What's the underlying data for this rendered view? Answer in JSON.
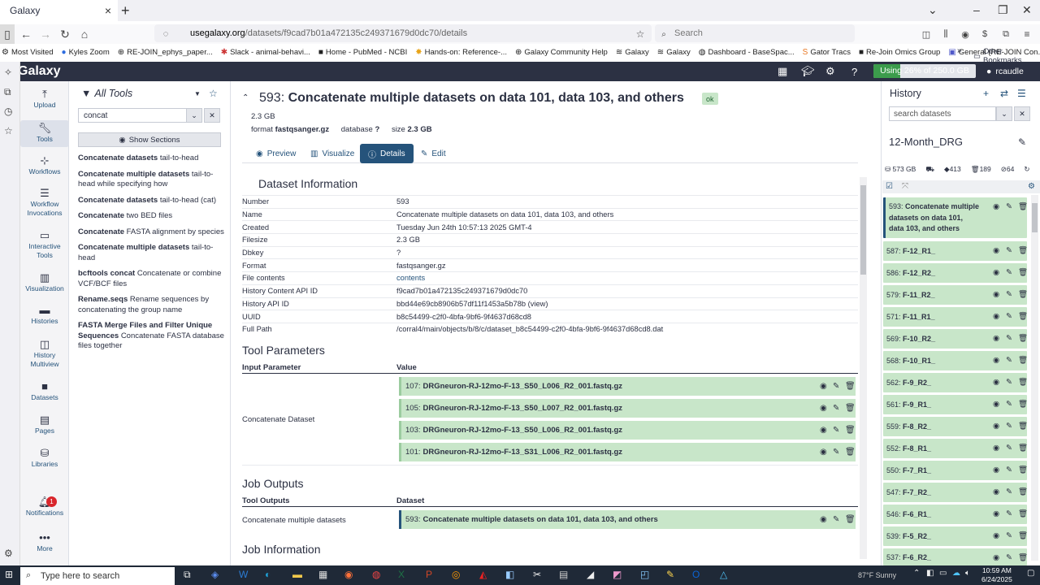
{
  "browser": {
    "tab_title": "Galaxy",
    "url_host": "usegalaxy.org",
    "url_path": "/datasets/f9cad7b01a472135c249371679d0dc70/details",
    "search_placeholder": "Search",
    "bookmarks": [
      "Most Visited",
      "Kyles Zoom",
      "RE-JOIN_ephys_paper...",
      "Slack - animal-behavi...",
      "Home - PubMed - NCBI",
      "Hands-on: Reference-...",
      "Galaxy Community Help",
      "Galaxy",
      "Galaxy",
      "Dashboard - BaseSpac...",
      "Gator Tracs",
      "Re-Join Omics Group",
      "General (RE-JOIN Con..."
    ],
    "other_bookmarks": "Other Bookmarks"
  },
  "galaxy": {
    "logo": "Galaxy",
    "quota_text": "Using 26% of 250.0 GB",
    "quota_fraction": 0.26,
    "user": "rcaudle"
  },
  "activity": {
    "items": [
      "Upload",
      "Tools",
      "Workflows",
      "Workflow Invocations",
      "Interactive Tools",
      "Visualization",
      "Histories",
      "History Multiview",
      "Datasets",
      "Pages",
      "Libraries"
    ],
    "notifications_label": "Notifications",
    "notifications_count": "1",
    "more_label": "More"
  },
  "tools": {
    "header": "All Tools",
    "search_value": "concat",
    "show_sections": "Show Sections",
    "list": [
      {
        "name": "Concatenate datasets",
        "desc": "tail-to-head"
      },
      {
        "name": "Concatenate multiple datasets",
        "desc": "tail-to-head while specifying how"
      },
      {
        "name": "Concatenate datasets",
        "desc": "tail-to-head (cat)"
      },
      {
        "name": "Concatenate",
        "desc": "two BED files"
      },
      {
        "name": "Concatenate",
        "desc": "FASTA alignment by species"
      },
      {
        "name": "Concatenate multiple datasets",
        "desc": "tail-to-head"
      },
      {
        "name": "bcftools concat",
        "desc": "Concatenate or combine VCF/BCF files"
      },
      {
        "name": "Rename.seqs",
        "desc": "Rename sequences by concatenating the group name"
      },
      {
        "name": "FASTA Merge Files and Filter Unique Sequences",
        "desc": "Concatenate FASTA database files together"
      }
    ]
  },
  "dataset": {
    "hid": "593:",
    "title": "Concatenate multiple datasets on data 101, data 103, and others",
    "state": "ok",
    "size_line": "2.3 GB",
    "format_label": "format",
    "format": "fastqsanger.gz",
    "database_label": "database",
    "database": "?",
    "size_label": "size",
    "size": "2.3 GB",
    "tabs": [
      "Preview",
      "Visualize",
      "Details",
      "Edit"
    ]
  },
  "info": {
    "heading": "Dataset Information",
    "rows": [
      {
        "k": "Number",
        "v": "593"
      },
      {
        "k": "Name",
        "v": "Concatenate multiple datasets on data 101, data 103, and others"
      },
      {
        "k": "Created",
        "v": "Tuesday Jun 24th 10:57:13 2025 GMT-4"
      },
      {
        "k": "Filesize",
        "v": "2.3 GB"
      },
      {
        "k": "Dbkey",
        "v": "?"
      },
      {
        "k": "Format",
        "v": "fastqsanger.gz"
      },
      {
        "k": "File contents",
        "v": "contents"
      },
      {
        "k": "History Content API ID",
        "v": "f9cad7b01a472135c249371679d0dc70"
      },
      {
        "k": "History API ID",
        "v": "bbd44e69cb8906b57df11f1453a5b78b (view)"
      },
      {
        "k": "UUID",
        "v": "b8c54499-c2f0-4bfa-9bf6-9f4637d68cd8"
      },
      {
        "k": "Full Path",
        "v": "/corral4/main/objects/b/8/c/dataset_b8c54499-c2f0-4bfa-9bf6-9f4637d68cd8.dat"
      }
    ]
  },
  "params": {
    "heading": "Tool Parameters",
    "col1": "Input Parameter",
    "col2": "Value",
    "input_name": "Concatenate Dataset",
    "inputs": [
      {
        "hid": "107:",
        "name": "DRGneuron-RJ-12mo-F-13_S50_L006_R2_001.fastq.gz"
      },
      {
        "hid": "105:",
        "name": "DRGneuron-RJ-12mo-F-13_S50_L007_R2_001.fastq.gz"
      },
      {
        "hid": "103:",
        "name": "DRGneuron-RJ-12mo-F-13_S50_L006_R2_001.fastq.gz"
      },
      {
        "hid": "101:",
        "name": "DRGneuron-RJ-12mo-F-13_S31_L006_R2_001.fastq.gz"
      }
    ]
  },
  "outputs": {
    "heading": "Job Outputs",
    "col1": "Tool Outputs",
    "col2": "Dataset",
    "name": "Concatenate multiple datasets",
    "hid": "593:",
    "value": "Concatenate multiple datasets on data 101, data 103, and others"
  },
  "jobinfo": {
    "heading": "Job Information"
  },
  "history": {
    "title": "History",
    "search_placeholder": "search datasets",
    "name": "12-Month_DRG",
    "size": "573 GB",
    "count_a": "413",
    "count_deleted": "189",
    "count_hidden": "64",
    "current": {
      "hid": "593:",
      "name": "Concatenate multiple datasets on data 101, data 103, and others"
    },
    "items": [
      {
        "hid": "587:",
        "name": "F-12_R1_"
      },
      {
        "hid": "586:",
        "name": "F-12_R2_"
      },
      {
        "hid": "579:",
        "name": "F-11_R2_"
      },
      {
        "hid": "571:",
        "name": "F-11_R1_"
      },
      {
        "hid": "569:",
        "name": "F-10_R2_"
      },
      {
        "hid": "568:",
        "name": "F-10_R1_"
      },
      {
        "hid": "562:",
        "name": "F-9_R2_"
      },
      {
        "hid": "561:",
        "name": "F-9_R1_"
      },
      {
        "hid": "559:",
        "name": "F-8_R2_"
      },
      {
        "hid": "552:",
        "name": "F-8_R1_"
      },
      {
        "hid": "550:",
        "name": "F-7_R1_"
      },
      {
        "hid": "547:",
        "name": "F-7_R2_"
      },
      {
        "hid": "546:",
        "name": "F-6_R1_"
      },
      {
        "hid": "539:",
        "name": "F-5_R2_"
      },
      {
        "hid": "537:",
        "name": "F-6_R2_"
      }
    ]
  },
  "taskbar": {
    "search_placeholder": "Type here to search",
    "weather": "87°F Sunny",
    "time": "10:59 AM",
    "date": "6/24/2025"
  }
}
